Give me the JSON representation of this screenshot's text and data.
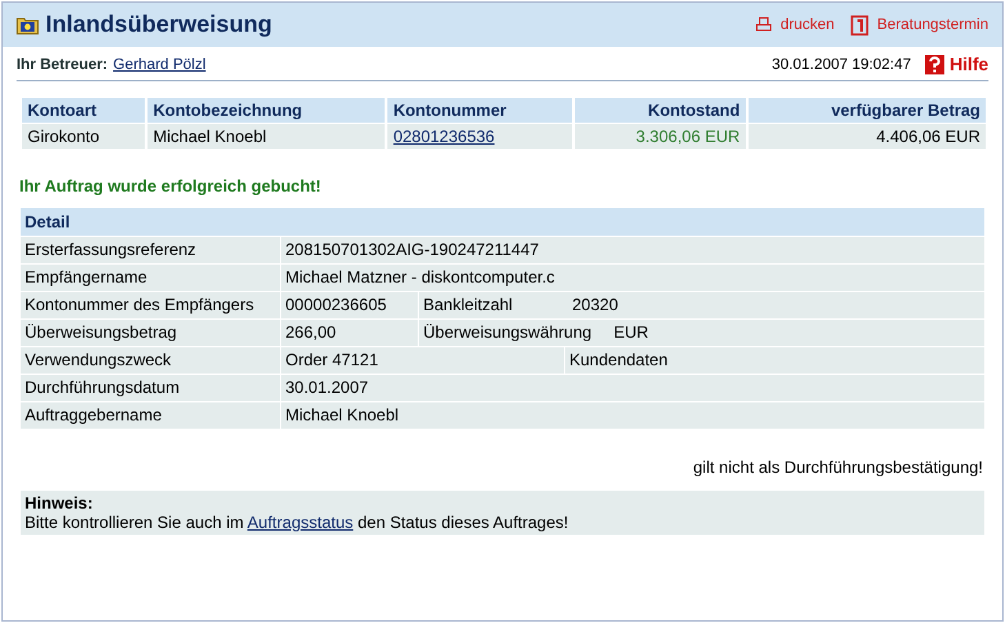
{
  "window": {
    "title": "Inlandsüberweisung"
  },
  "header_links": [
    {
      "kind": "print",
      "label": "drucken"
    },
    {
      "kind": "calendar",
      "label": "Beratungstermin"
    }
  ],
  "advisor": {
    "label": "Ihr Betreuer:",
    "name": "Gerhard Pölzl"
  },
  "timestamp": "30.01.2007 19:02:47",
  "help": "Hilfe",
  "accounts": {
    "columns": [
      "Kontoart",
      "Kontobezeichnung",
      "Kontonummer",
      "Kontostand",
      "verfügbarer Betrag"
    ],
    "rows": [
      {
        "type": "Girokonto",
        "name": "Michael Knoebl",
        "number": "02801236536",
        "balance": "3.306,06 EUR",
        "available": "4.406,06 EUR"
      }
    ]
  },
  "success_message": "Ihr Auftrag wurde erfolgreich gebucht!",
  "detail": {
    "title": "Detail",
    "rows": [
      {
        "kind": "single",
        "label": "Ersterfassungsreferenz",
        "value": "208150701302AIG-190247211447"
      },
      {
        "kind": "single",
        "label": "Empfängername",
        "value": "Michael Matzner - diskontcomputer.c"
      },
      {
        "kind": "pair",
        "label": "Kontonummer des Empfängers",
        "value": "00000236605",
        "label2": "Bankleitzahl",
        "value2": "20320"
      },
      {
        "kind": "pair",
        "label": "Überweisungsbetrag",
        "value": "266,00",
        "label2": "Überweisungswährung",
        "value2": "EUR"
      },
      {
        "kind": "note",
        "label": "Verwendungszweck",
        "value": "Order 47121",
        "note": "Kundendaten"
      },
      {
        "kind": "single",
        "label": "Durchführungsdatum",
        "value": "30.01.2007"
      },
      {
        "kind": "single",
        "label": "Auftraggebername",
        "value": "Michael Knoebl"
      }
    ]
  },
  "disclaimer": "gilt nicht als Durchführungsbestätigung!",
  "hint": {
    "title": "Hinweis:",
    "before": "Bitte kontrollieren Sie auch im",
    "link": "Auftragsstatus",
    "after": "den Status dieses Auftrages!"
  }
}
